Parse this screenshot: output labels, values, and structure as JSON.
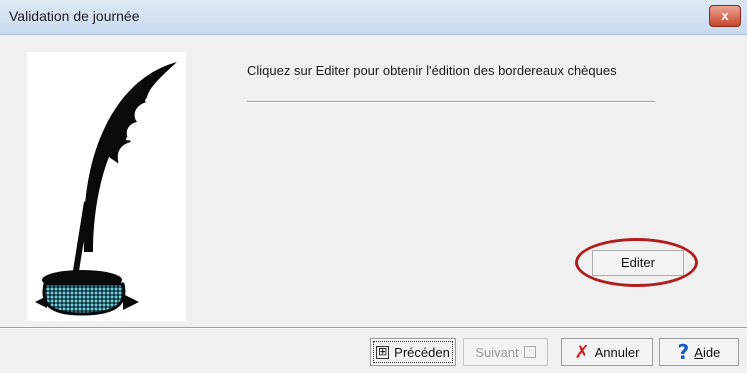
{
  "window": {
    "title": "Validation de journée",
    "close_glyph": "x"
  },
  "main": {
    "message": "Cliquez sur Editer pour obtenir l'édition des bordereaux chèques",
    "edit_label": "Editer",
    "highlight_color": "#b01f1f"
  },
  "footer": {
    "prev_label": "Précéden",
    "next_label": "Suivant",
    "cancel_label": "Annuler",
    "help_label": "Aide"
  },
  "icons": {
    "illustration": "quill-inkwell-icon",
    "prev": "prev-page-icon",
    "next": "next-page-icon",
    "cancel": "red-x-icon",
    "help": "question-mark-icon"
  }
}
